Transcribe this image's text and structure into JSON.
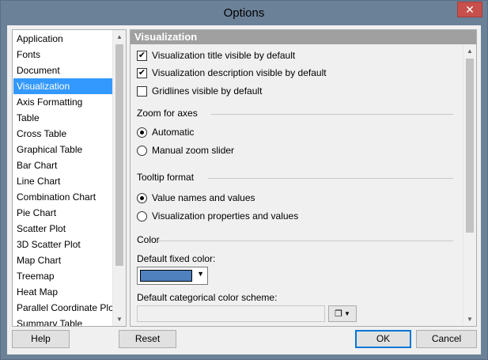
{
  "window": {
    "title": "Options",
    "close_glyph": "✕"
  },
  "nav": {
    "items": [
      {
        "label": "Application"
      },
      {
        "label": "Fonts"
      },
      {
        "label": "Document"
      },
      {
        "label": "Visualization",
        "selected": true
      },
      {
        "label": "Axis Formatting"
      },
      {
        "label": "Table"
      },
      {
        "label": "Cross Table"
      },
      {
        "label": "Graphical Table"
      },
      {
        "label": "Bar Chart"
      },
      {
        "label": "Line Chart"
      },
      {
        "label": "Combination Chart"
      },
      {
        "label": "Pie Chart"
      },
      {
        "label": "Scatter Plot"
      },
      {
        "label": "3D Scatter Plot"
      },
      {
        "label": "Map Chart"
      },
      {
        "label": "Treemap"
      },
      {
        "label": "Heat Map"
      },
      {
        "label": "Parallel Coordinate Plot"
      },
      {
        "label": "Summary Table"
      }
    ]
  },
  "panel": {
    "header": "Visualization",
    "checkboxes": [
      {
        "label": "Visualization title visible by default",
        "checked": true
      },
      {
        "label": "Visualization description visible by default",
        "checked": true
      },
      {
        "label": "Gridlines visible by default",
        "checked": false
      }
    ],
    "zoom": {
      "title": "Zoom for axes",
      "options": [
        {
          "label": "Automatic",
          "checked": true
        },
        {
          "label": "Manual zoom slider",
          "checked": false
        }
      ]
    },
    "tooltip": {
      "title": "Tooltip format",
      "options": [
        {
          "label": "Value names and values",
          "checked": true
        },
        {
          "label": "Visualization properties and values",
          "checked": false
        }
      ]
    },
    "color": {
      "title": "Color",
      "fixed_color_label": "Default fixed color:",
      "fixed_color_value": "#4e81bd",
      "scheme_label": "Default categorical color scheme:",
      "scheme_value": ""
    }
  },
  "buttons": {
    "help": "Help",
    "reset": "Reset",
    "ok": "OK",
    "cancel": "Cancel"
  },
  "colors": {
    "selection": "#3399ff",
    "header_bg": "#a0a0a0",
    "close_bg": "#c7504c"
  }
}
